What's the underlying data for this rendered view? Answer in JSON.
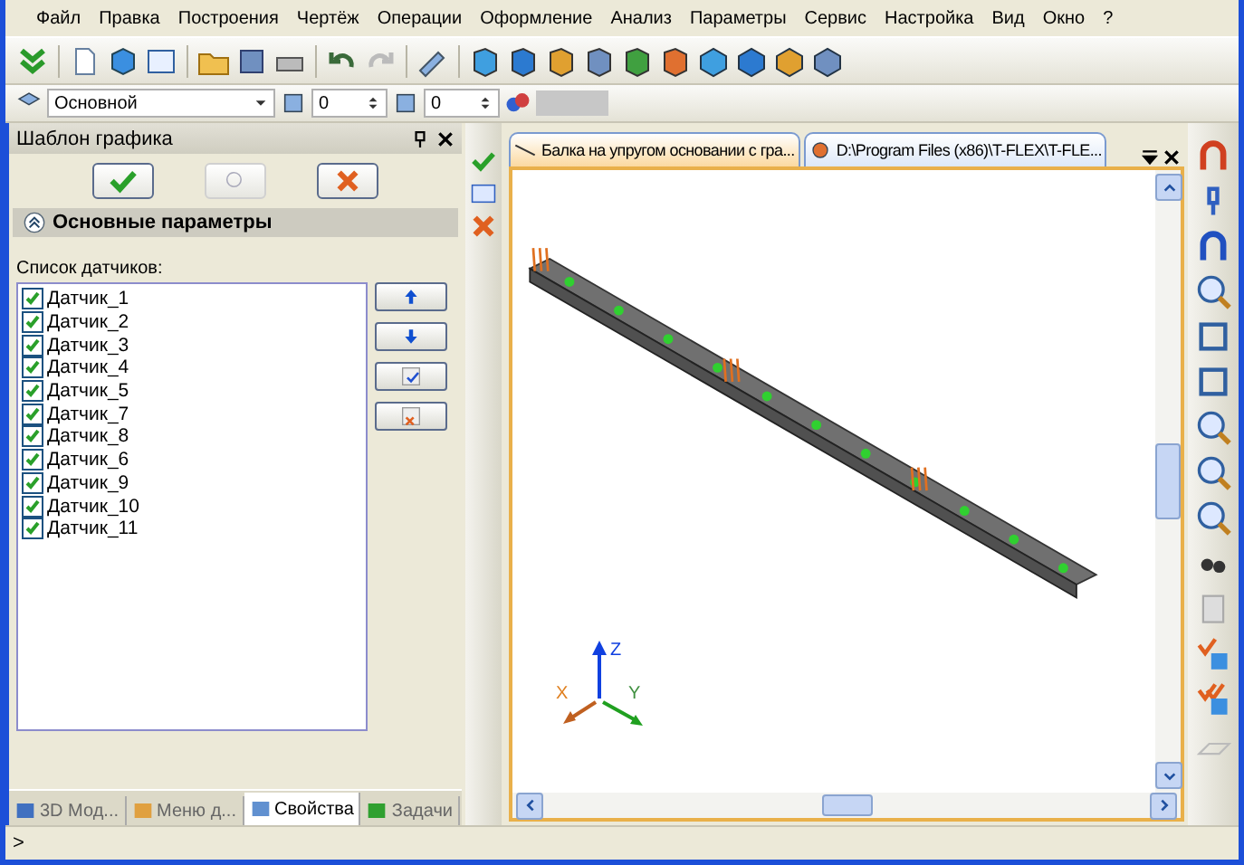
{
  "menu": [
    {
      "label": "Файл"
    },
    {
      "label": "Правка"
    },
    {
      "label": "Построения"
    },
    {
      "label": "Чертёж"
    },
    {
      "label": "Операции"
    },
    {
      "label": "Оформление"
    },
    {
      "label": "Анализ"
    },
    {
      "label": "Параметры"
    },
    {
      "label": "Сервис"
    },
    {
      "label": "Настройка"
    },
    {
      "label": "Вид"
    },
    {
      "label": "Окно"
    },
    {
      "label": "?"
    }
  ],
  "properties_bar": {
    "layer": "Основной",
    "spin_values": [
      "0",
      "0"
    ]
  },
  "panel": {
    "title": "Шаблон графика",
    "section": {
      "title": "Основные параметры",
      "expanded": true
    },
    "list_label": "Список датчиков:",
    "sensors": [
      {
        "label": "Датчик_1",
        "checked": true
      },
      {
        "label": "Датчик_2",
        "checked": true
      },
      {
        "label": "Датчик_3",
        "checked": true
      },
      {
        "label": "Датчик_4",
        "checked": true
      },
      {
        "label": "Датчик_5",
        "checked": true
      },
      {
        "label": "Датчик_7",
        "checked": true
      },
      {
        "label": "Датчик_8",
        "checked": true
      },
      {
        "label": "Датчик_6",
        "checked": true
      },
      {
        "label": "Датчик_9",
        "checked": true
      },
      {
        "label": "Датчик_10",
        "checked": true
      },
      {
        "label": "Датчик_11",
        "checked": true
      }
    ]
  },
  "panel_tabs": [
    {
      "label": "3D Мод...",
      "selected": false
    },
    {
      "label": "Меню д...",
      "selected": false
    },
    {
      "label": "Свойства",
      "selected": true
    },
    {
      "label": "Задачи",
      "selected": false
    }
  ],
  "document_tabs": [
    {
      "label": "Балка на упругом основании с гра...",
      "selected": true
    },
    {
      "label": "D:\\Program Files (x86)\\T-FLEX\\T-FLE...",
      "selected": false
    }
  ],
  "viewport": {
    "axis_labels": [
      "X",
      "Y",
      "Z"
    ]
  },
  "command_line": {
    "prompt": ">"
  }
}
